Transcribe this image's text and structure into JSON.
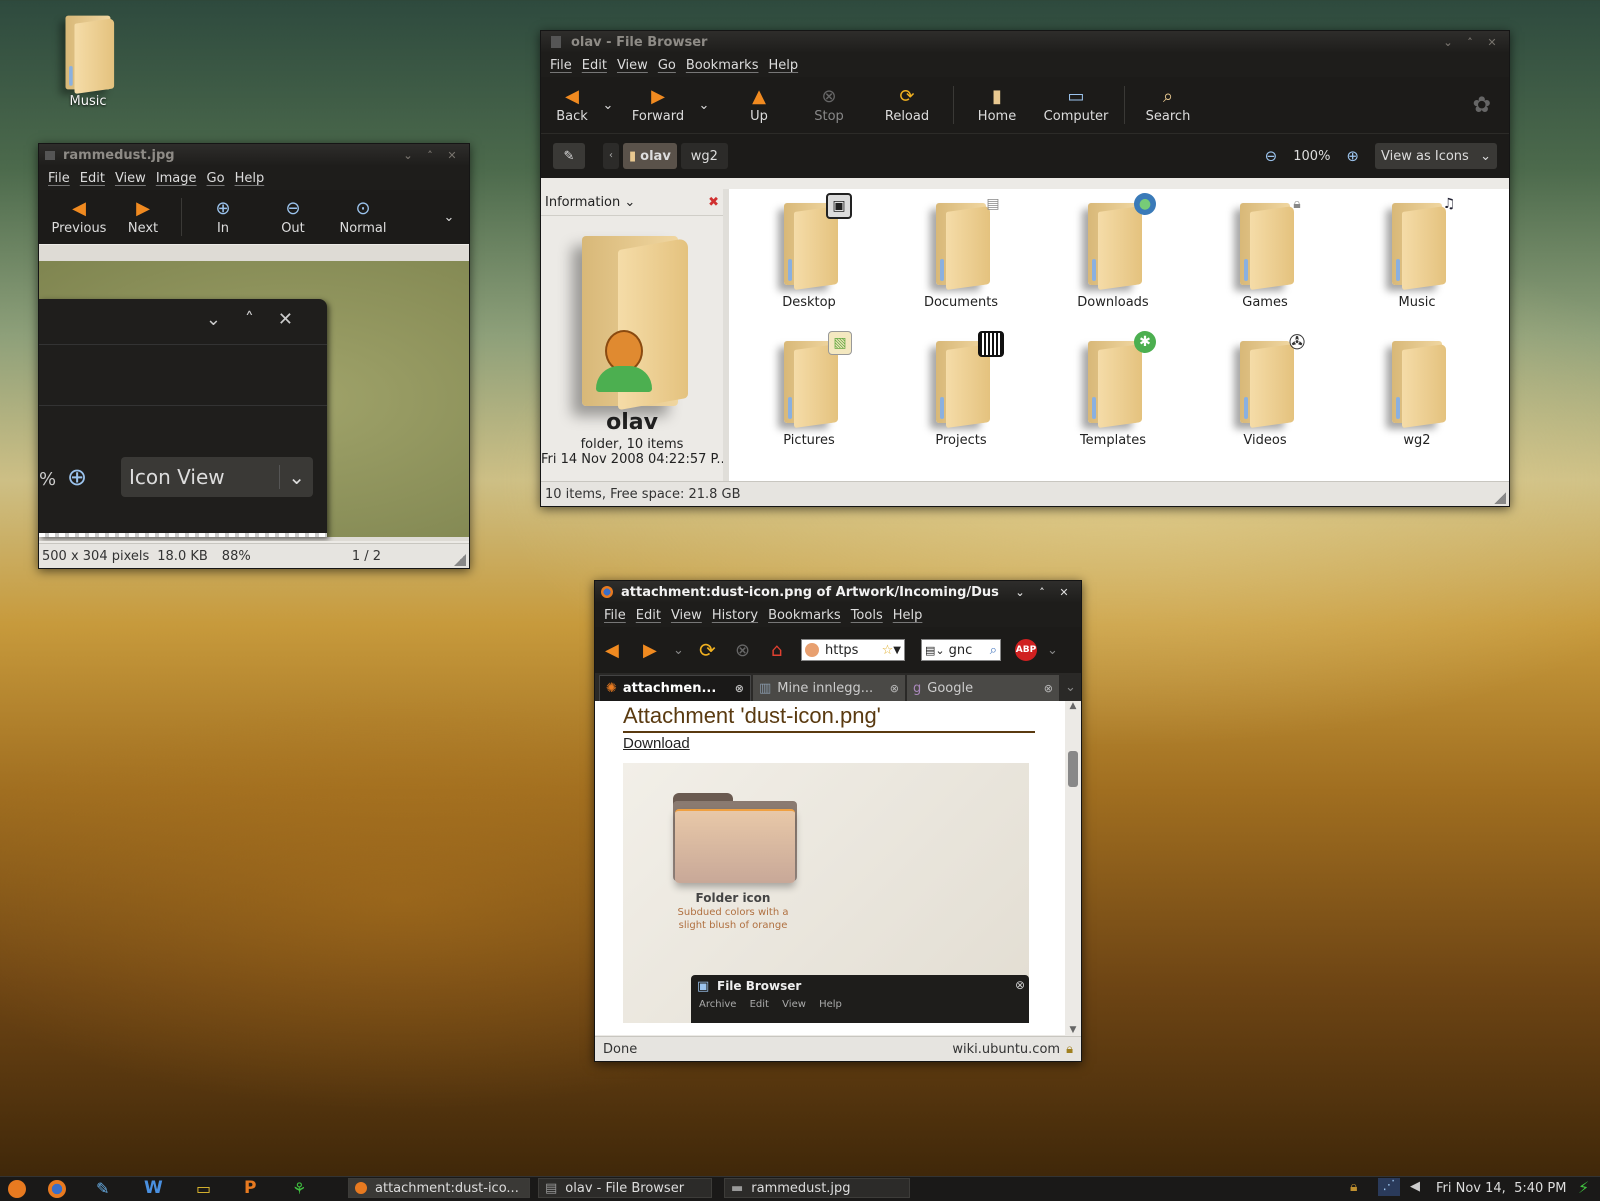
{
  "desktop": {
    "icons": [
      {
        "label": "Music",
        "icon": "folder-icon"
      }
    ]
  },
  "image_viewer": {
    "title": "rammedust.jpg",
    "menu": [
      "File",
      "Edit",
      "View",
      "Image",
      "Go",
      "Help"
    ],
    "toolbar": {
      "previous": "Previous",
      "next": "Next",
      "zoom_in": "In",
      "zoom_out": "Out",
      "normal": "Normal"
    },
    "embedded": {
      "icon_view_label": "Icon View",
      "percent_fragment": "%"
    },
    "status": {
      "dimensions": "500 x 304 pixels",
      "size": "18.0 KB",
      "zoom": "88%",
      "page": "1 / 2"
    }
  },
  "file_browser": {
    "title": "olav - File Browser",
    "menu": [
      "File",
      "Edit",
      "View",
      "Go",
      "Bookmarks",
      "Help"
    ],
    "toolbar": {
      "back": "Back",
      "forward": "Forward",
      "up": "Up",
      "stop": "Stop",
      "reload": "Reload",
      "home": "Home",
      "computer": "Computer",
      "search": "Search"
    },
    "path": {
      "current": "olav",
      "next": "wg2"
    },
    "zoom": "100%",
    "view_mode": "View as Icons",
    "sidebar": {
      "header": "Information",
      "name": "olav",
      "kind": "folder, 10 items",
      "date": "Fri 14 Nov 2008 04:22:57 P..."
    },
    "items": [
      {
        "name": "Desktop",
        "emblem": "desktop-emblem-icon"
      },
      {
        "name": "Documents",
        "emblem": "documents-emblem-icon"
      },
      {
        "name": "Downloads",
        "emblem": "globe-emblem-icon"
      },
      {
        "name": "Games",
        "emblem": "lock-emblem-icon"
      },
      {
        "name": "Music",
        "emblem": "speaker-emblem-icon"
      },
      {
        "name": "Pictures",
        "emblem": "pictures-emblem-icon"
      },
      {
        "name": "Projects",
        "emblem": "barcode-emblem-icon"
      },
      {
        "name": "Templates",
        "emblem": "star-emblem-icon"
      },
      {
        "name": "Videos",
        "emblem": "film-emblem-icon"
      },
      {
        "name": "wg2",
        "emblem": ""
      }
    ],
    "status": "10 items, Free space: 21.8 GB"
  },
  "browser": {
    "title": "attachment:dust-icon.png of Artwork/Incoming/Dus",
    "menu": [
      "File",
      "Edit",
      "View",
      "History",
      "Bookmarks",
      "Tools",
      "Help"
    ],
    "url_text": "https",
    "search_text": "gnc",
    "tabs": [
      "attachmen...",
      "Mine innlegg...",
      "Google"
    ],
    "page": {
      "heading": "Attachment 'dust-icon.png'",
      "download": "Download",
      "preview_title": "Folder icon",
      "preview_desc_1": "Subdued colors with a",
      "preview_desc_2": "slight blush of orange",
      "mini_title": "File Browser",
      "mini_menu": [
        "Archive",
        "Edit",
        "View",
        "Help"
      ]
    },
    "status_left": "Done",
    "status_right": "wiki.ubuntu.com"
  },
  "taskbar": {
    "tasks": [
      "attachment:dust-ico...",
      "olav - File Browser",
      "rammedust.jpg"
    ],
    "clock": "Fri Nov 14,  5:40 PM"
  }
}
